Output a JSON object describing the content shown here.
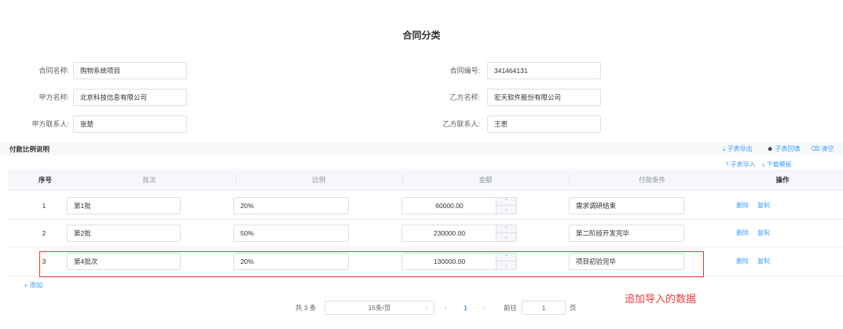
{
  "page_title": "合同分类",
  "form": {
    "contract_name": {
      "label": "合同名称:",
      "value": "购物系统项目"
    },
    "contract_no": {
      "label": "合同编号:",
      "value": "341464131"
    },
    "party_a": {
      "label": "甲方名称:",
      "value": "北京科技信息有限公司"
    },
    "party_b": {
      "label": "乙方名称:",
      "value": "宏天软件股份有限公司"
    },
    "party_a_contact": {
      "label": "甲方联系人:",
      "value": "张楚"
    },
    "party_b_contact": {
      "label": "乙方联系人:",
      "value": "王思"
    }
  },
  "section": {
    "title": "付款比例说明"
  },
  "toolbar": {
    "export": "子表导出",
    "backfill": "子表回填",
    "clear": "清空",
    "import": "子表导入",
    "download_template": "下载模板"
  },
  "table": {
    "columns": [
      "序号",
      "批次",
      "比例",
      "金额",
      "付款条件",
      "操作"
    ],
    "rows": [
      {
        "index": "1",
        "batch": "第1批",
        "ratio": "20%",
        "amount": "60000.00",
        "condition": "需求调研结束",
        "delete": "删除",
        "copy": "复制"
      },
      {
        "index": "2",
        "batch": "第2批",
        "ratio": "50%",
        "amount": "230000.00",
        "condition": "第二阶段开发完毕",
        "delete": "删除",
        "copy": "复制"
      },
      {
        "index": "3",
        "batch": "第4批次",
        "ratio": "20%",
        "amount": "130000.00",
        "condition": "项目初验完毕",
        "delete": "删除",
        "copy": "复制"
      }
    ],
    "add_label": "+ 添加"
  },
  "annotation": "追加导入的数据",
  "pagination": {
    "total": "共 3 条",
    "page_size": "15条/页",
    "current_page": "1",
    "goto_label": "前往",
    "goto_value": "1",
    "page_suffix": "页"
  },
  "colors": {
    "accent": "#409eff",
    "highlight": "#e83b3b"
  }
}
